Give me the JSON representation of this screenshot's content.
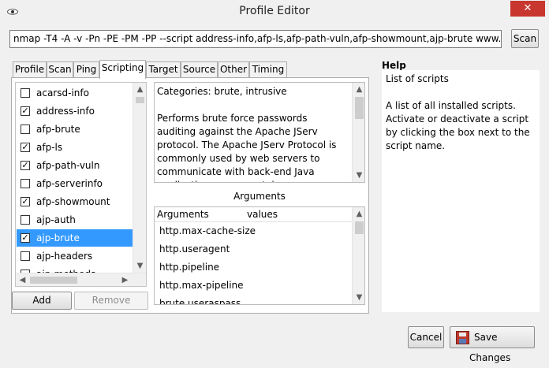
{
  "window": {
    "title": "Profile Editor",
    "close_glyph": "✕"
  },
  "command": {
    "value": "nmap -T4 -A -v -Pn -PE -PM -PP --script address-info,afp-ls,afp-path-vuln,afp-showmount,ajp-brute www.softpedia.com",
    "scan_label": "Scan"
  },
  "tabs": [
    {
      "label": "Profile"
    },
    {
      "label": "Scan"
    },
    {
      "label": "Ping"
    },
    {
      "label": "Scripting",
      "active": true
    },
    {
      "label": "Target"
    },
    {
      "label": "Source"
    },
    {
      "label": "Other"
    },
    {
      "label": "Timing"
    }
  ],
  "scripts": [
    {
      "name": "acarsd-info",
      "checked": false
    },
    {
      "name": "address-info",
      "checked": true
    },
    {
      "name": "afp-brute",
      "checked": false
    },
    {
      "name": "afp-ls",
      "checked": true
    },
    {
      "name": "afp-path-vuln",
      "checked": true
    },
    {
      "name": "afp-serverinfo",
      "checked": false
    },
    {
      "name": "afp-showmount",
      "checked": true
    },
    {
      "name": "ajp-auth",
      "checked": false
    },
    {
      "name": "ajp-brute",
      "checked": true,
      "selected": true
    },
    {
      "name": "ajp-headers",
      "checked": false
    },
    {
      "name": "ajp-methods",
      "checked": false
    }
  ],
  "list_buttons": {
    "add": "Add",
    "remove": "Remove"
  },
  "description": {
    "categories": "Categories: brute, intrusive",
    "body": "Performs brute force passwords auditing against the Apache JServ protocol. The Apache JServ Protocol is commonly used by web servers to communicate with back-end Java application server containers."
  },
  "arguments": {
    "title": "Arguments",
    "col_name": "Arguments",
    "col_values": "values",
    "rows": [
      "http.max-cache-size",
      "http.useragent",
      "http.pipeline",
      "http.max-pipeline",
      "brute.useraspass"
    ]
  },
  "help": {
    "label": "Help",
    "heading": "List of scripts",
    "text": "A list of all installed scripts. Activate or deactivate a script by clicking the box next to the script name."
  },
  "footer": {
    "cancel": "Cancel",
    "save": "Save Changes"
  },
  "colors": {
    "selection": "#3399ff",
    "close": "#c7362f"
  }
}
